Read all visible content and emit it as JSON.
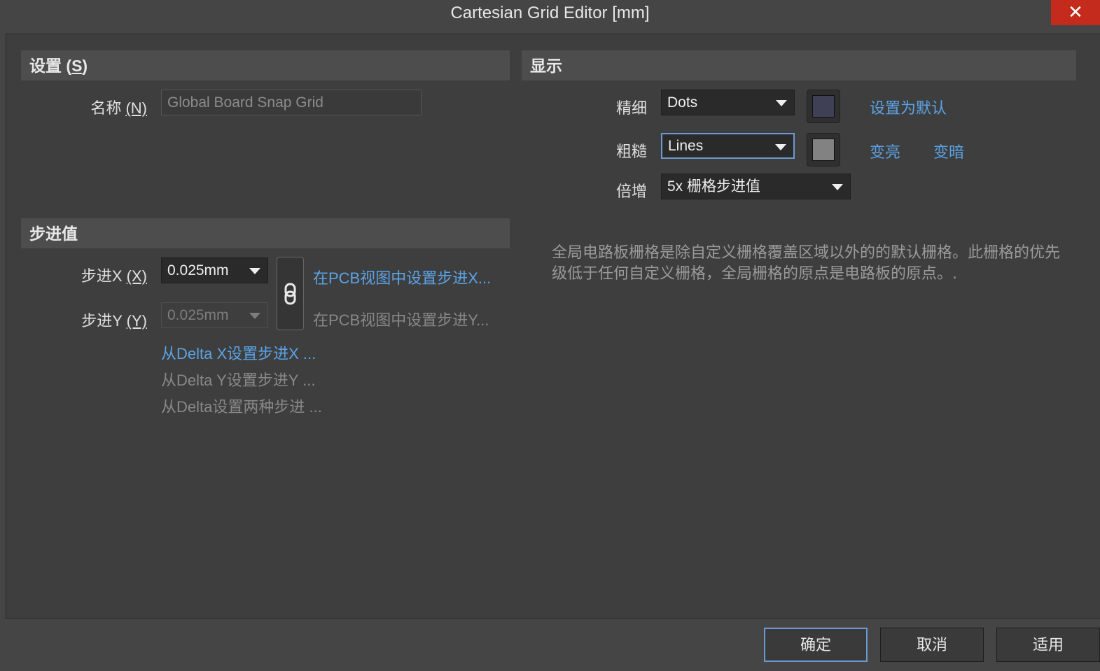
{
  "window": {
    "title": "Cartesian Grid Editor [mm]",
    "close_glyph": "✕"
  },
  "settings": {
    "header_prefix": "设置 (",
    "header_key": "S",
    "header_suffix": ")",
    "name_label": "名称 ",
    "name_key": "(N)",
    "name_value": "Global Board Snap Grid"
  },
  "step": {
    "header": "步进值",
    "x_label": "步进X ",
    "x_key": "(X)",
    "x_value": "0.025mm",
    "y_label": "步进Y ",
    "y_key": "(Y)",
    "y_value": "0.025mm",
    "set_x_link": "在PCB视图中设置步进X...",
    "set_y_link": "在PCB视图中设置步进Y...",
    "delta_x_link": "从Delta X设置步进X ...",
    "delta_y_link": "从Delta Y设置步进Y ...",
    "delta_both_link": "从Delta设置两种步进 ..."
  },
  "display": {
    "header": "显示",
    "fine_label": "精细",
    "fine_value": "Dots",
    "fine_color": "#3f3f55",
    "coarse_label": "粗糙",
    "coarse_value": "Lines",
    "coarse_color": "#828282",
    "multiplier_label": "倍增",
    "multiplier_value": "5x 栅格步进值",
    "set_default_link": "设置为默认",
    "lighter_link": "变亮",
    "darker_link": "变暗",
    "description": "全局电路板栅格是除自定义栅格覆盖区域以外的的默认栅格。此栅格的优先级低于任何自定义栅格，全局栅格的原点是电路板的原点。."
  },
  "footer": {
    "ok": "确定",
    "cancel": "取消",
    "apply": "适用"
  },
  "colors": {
    "accent": "#5ba3e6",
    "close": "#c42b1c",
    "focus_border": "#6a9ad0"
  }
}
